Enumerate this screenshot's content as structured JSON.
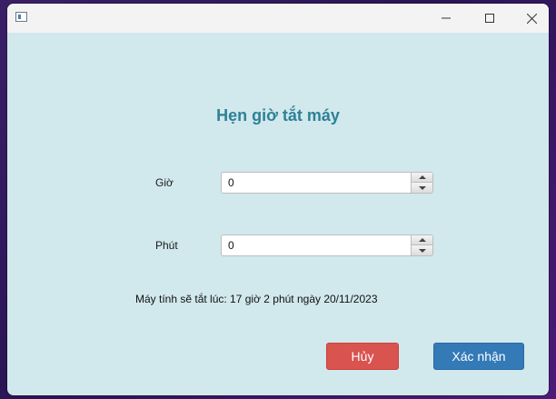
{
  "window": {
    "minimize_icon": "minimize-icon",
    "maximize_icon": "maximize-icon",
    "close_icon": "close-icon"
  },
  "form": {
    "title": "Hẹn giờ tắt máy",
    "hour": {
      "label": "Giờ",
      "value": "0"
    },
    "minute": {
      "label": "Phút",
      "value": "0"
    },
    "info_text": "Máy tính sẽ tắt lúc: 17 giờ 2 phút ngày 20/11/2023"
  },
  "buttons": {
    "cancel_label": "Hủy",
    "confirm_label": "Xác nhận"
  },
  "colors": {
    "background": "#d1e8ec",
    "title": "#2d8196",
    "cancel": "#d9534f",
    "confirm": "#337ab7"
  }
}
